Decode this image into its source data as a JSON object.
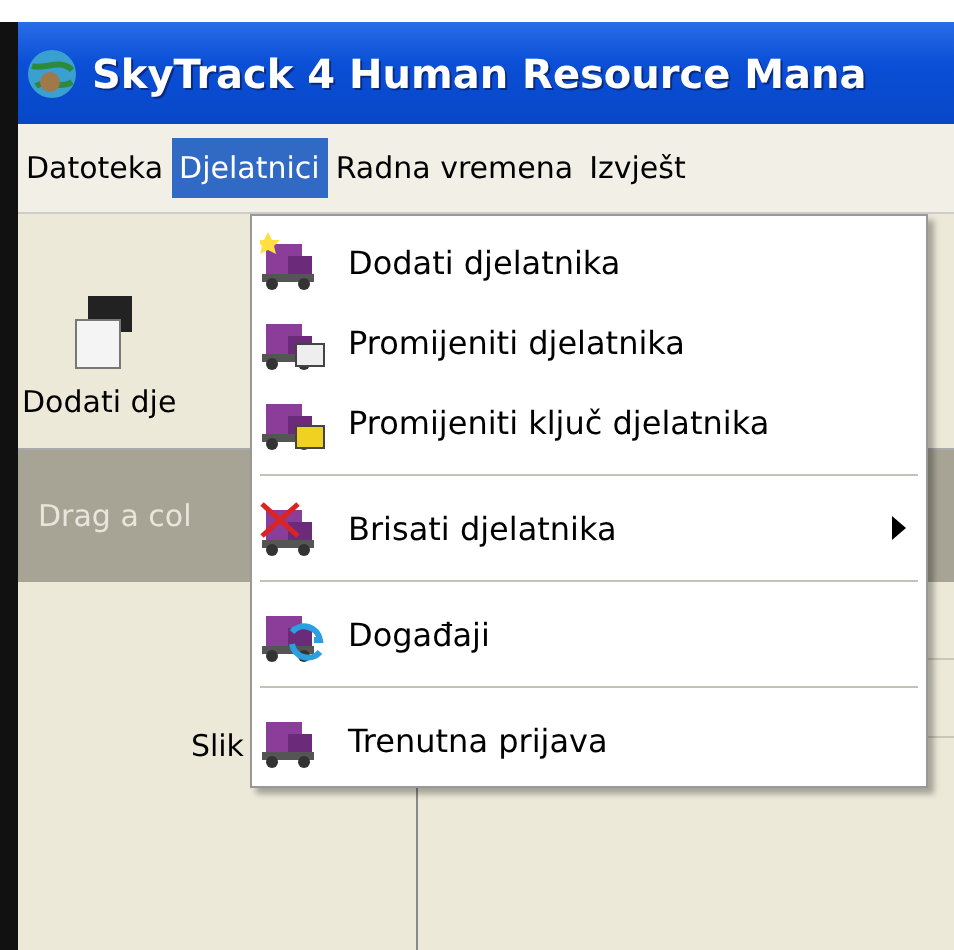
{
  "window": {
    "title": "SkyTrack 4 Human Resource Mana"
  },
  "menu_bar": [
    {
      "label": "Datoteka",
      "selected": false
    },
    {
      "label": "Djelatnici",
      "selected": true
    },
    {
      "label": "Radna vremena",
      "selected": false
    },
    {
      "label": "Izvješt",
      "selected": false
    }
  ],
  "toolbar": {
    "button_label": "Dodati dje"
  },
  "group_bar": {
    "text": "Drag a col"
  },
  "grid": {
    "column_label": "Slik"
  },
  "dropdown_menu": [
    {
      "kind": "item",
      "label": "Dodati djelatnika",
      "submenu": false
    },
    {
      "kind": "item",
      "label": "Promijeniti djelatnika",
      "submenu": false
    },
    {
      "kind": "item",
      "label": "Promijeniti ključ djelatnika",
      "submenu": false
    },
    {
      "kind": "separator"
    },
    {
      "kind": "item",
      "label": "Brisati djelatnika",
      "submenu": true
    },
    {
      "kind": "separator"
    },
    {
      "kind": "item",
      "label": "Događaji",
      "submenu": false
    },
    {
      "kind": "separator"
    },
    {
      "kind": "item",
      "label": "Trenutna prijava",
      "submenu": false
    }
  ]
}
